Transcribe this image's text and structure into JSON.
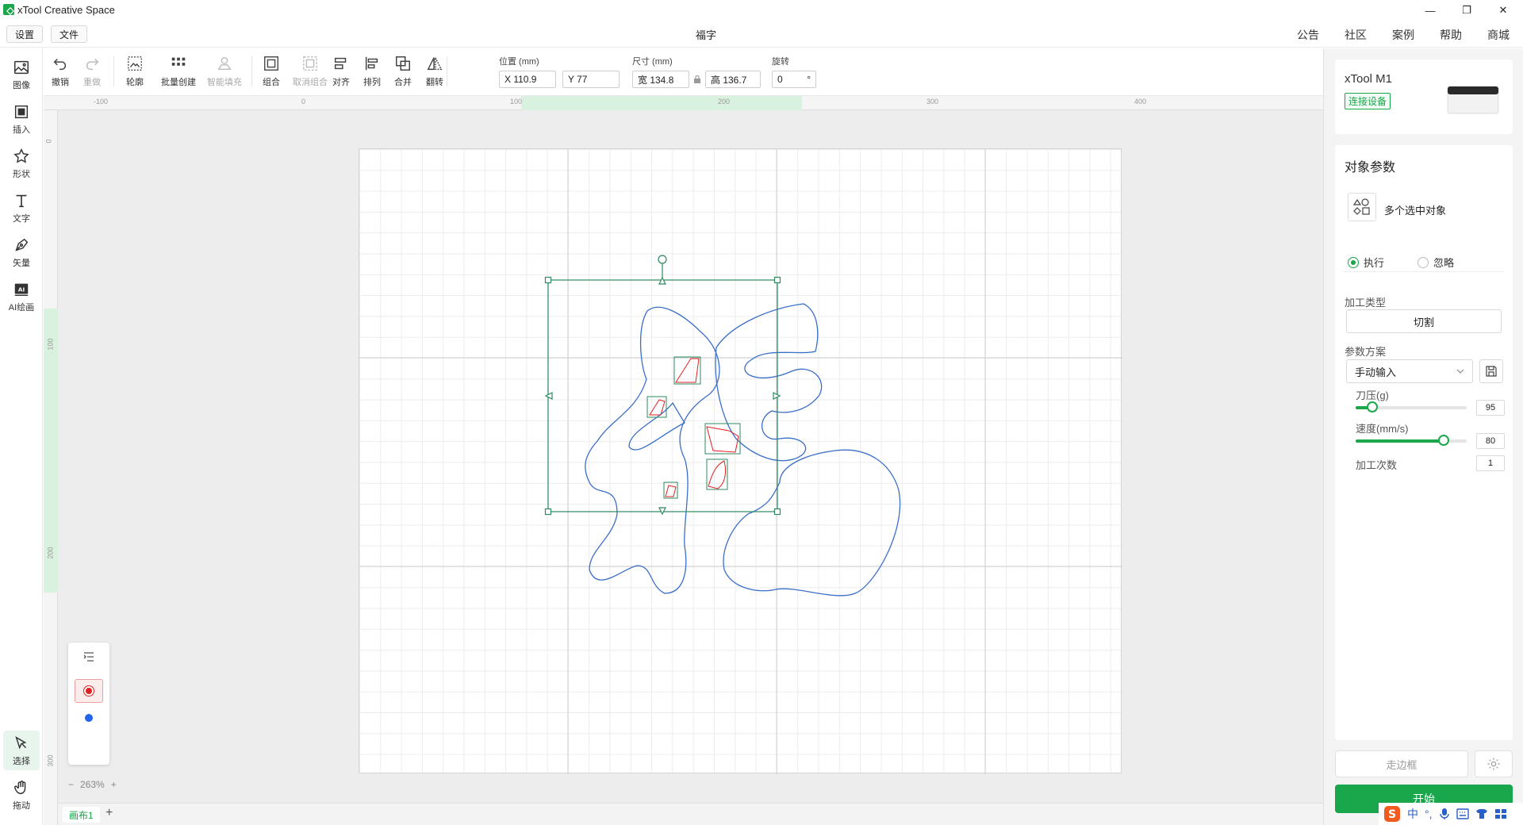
{
  "window": {
    "title": "xTool Creative Space",
    "minimize": "—",
    "restore": "❐",
    "close": "✕"
  },
  "menubar": {
    "settings": "设置",
    "file": "文件",
    "doc_title": "福字",
    "links": [
      "公告",
      "社区",
      "案例",
      "帮助",
      "商城"
    ]
  },
  "lefttools": [
    {
      "label": "图像",
      "icon": "image-icon"
    },
    {
      "label": "插入",
      "icon": "insert-icon"
    },
    {
      "label": "形状",
      "icon": "star-icon"
    },
    {
      "label": "文字",
      "icon": "text-icon"
    },
    {
      "label": "矢量",
      "icon": "pen-icon"
    },
    {
      "label": "AI绘画",
      "icon": "ai-icon"
    },
    {
      "label": "选择",
      "icon": "cursor-icon"
    },
    {
      "label": "拖动",
      "icon": "hand-icon"
    }
  ],
  "toolbar": {
    "undo": "撤销",
    "redo": "重做",
    "outline": "轮廓",
    "batch_create": "批量创建",
    "smart_fill": "智能填充",
    "group": "组合",
    "ungroup": "取消组合",
    "align": "对齐",
    "arrange": "排列",
    "combine": "合并",
    "flip": "翻转",
    "position_label": "位置 (mm)",
    "x_value": "X 110.9",
    "y_value": "Y 77",
    "size_label": "尺寸 (mm)",
    "width_value": "宽 134.8",
    "height_value": "高 136.7",
    "rotate_label": "旋转",
    "rotate_value": "0",
    "rotate_unit": "°"
  },
  "ruler": {
    "top": [
      "-100",
      "0",
      "100",
      "200",
      "300",
      "400"
    ],
    "left": [
      "0",
      "100",
      "200",
      "300"
    ]
  },
  "canvas": {
    "zoom": "263%",
    "zoom_minus": "−",
    "zoom_plus": "+",
    "tab": "画布1",
    "tab_add": "+"
  },
  "layers": {
    "colors": [
      "#e02020",
      "#2563eb"
    ]
  },
  "rightpanel": {
    "device_name": "xTool M1",
    "connect": "连接设备",
    "props_title": "对象参数",
    "multi_selected": "多个选中对象",
    "execute": "执行",
    "ignore": "忽略",
    "process_type_label": "加工类型",
    "process_type": "切割",
    "param_scheme_label": "参数方案",
    "param_scheme": "手动输入",
    "pressure_label": "刀压(g)",
    "pressure": "95",
    "pressure_fraction": 0.15,
    "speed_label": "速度(mm/s)",
    "speed": "80",
    "speed_fraction": 0.79,
    "passes_label": "加工次数",
    "passes": "1",
    "frame": "走边框",
    "start": "开始"
  },
  "ime": {
    "lang": "中",
    "punct": "°,"
  },
  "colors": {
    "accent": "#1aa64a",
    "cut_red": "#e02020",
    "path_blue": "#3a6ec8"
  }
}
